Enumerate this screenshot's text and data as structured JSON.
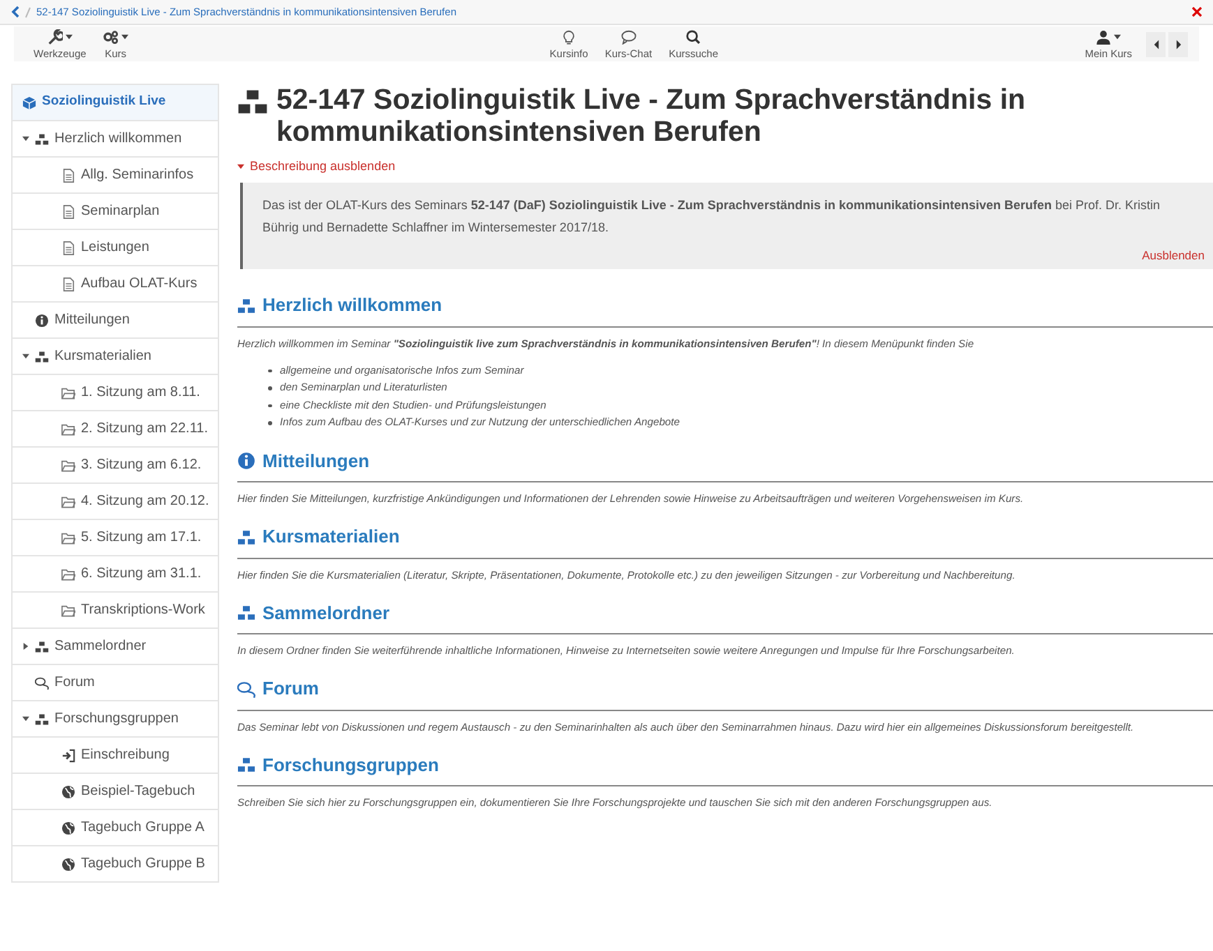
{
  "breadcrumb": {
    "text": "52-147 Soziolinguistik Live - Zum Sprachverständnis in kommunikationsintensiven Berufen"
  },
  "toolbar": {
    "left": [
      {
        "label": "Werkzeuge",
        "kind": "wrench"
      },
      {
        "label": "Kurs",
        "kind": "gears"
      }
    ],
    "center": [
      {
        "label": "Kursinfo",
        "kind": "bulb"
      },
      {
        "label": "Kurs-Chat",
        "kind": "chat"
      },
      {
        "label": "Kurssuche",
        "kind": "search"
      }
    ],
    "right": [
      {
        "label": "Mein Kurs",
        "kind": "user"
      }
    ]
  },
  "sidebar": {
    "root": {
      "label": "Soziolinguistik Live",
      "selected": true
    },
    "items": [
      {
        "label": "Herzlich willkommen",
        "kind": "cubes",
        "selected": false,
        "expanded": true,
        "children": [
          {
            "label": "Allg. Seminarinfos",
            "kind": "doc",
            "selected": false
          },
          {
            "label": "Seminarplan",
            "kind": "doc",
            "selected": false
          },
          {
            "label": "Leistungen",
            "kind": "doc",
            "selected": false
          },
          {
            "label": "Aufbau OLAT-Kurs",
            "kind": "doc",
            "selected": false
          }
        ]
      },
      {
        "label": "Mitteilungen",
        "kind": "info",
        "selected": false
      },
      {
        "label": "Kursmaterialien",
        "kind": "cubes",
        "selected": false,
        "expanded": true,
        "children": [
          {
            "label": "1. Sitzung am 8.11.",
            "kind": "folder",
            "selected": false
          },
          {
            "label": "2. Sitzung am 22.11.",
            "kind": "folder",
            "selected": false
          },
          {
            "label": "3. Sitzung am 6.12.",
            "kind": "folder",
            "selected": false
          },
          {
            "label": "4. Sitzung am 20.12.",
            "kind": "folder",
            "selected": false
          },
          {
            "label": "5. Sitzung am 17.1.",
            "kind": "folder",
            "selected": false
          },
          {
            "label": "6. Sitzung am 31.1.",
            "kind": "folder",
            "selected": false
          },
          {
            "label": "Transkriptions-Work",
            "kind": "folder",
            "selected": false
          }
        ]
      },
      {
        "label": "Sammelordner",
        "kind": "cubes",
        "selected": false,
        "expanded": false
      },
      {
        "label": "Forum",
        "kind": "forum",
        "selected": false
      },
      {
        "label": "Forschungsgruppen",
        "kind": "cubes",
        "selected": false,
        "expanded": true,
        "children": [
          {
            "label": "Einschreibung",
            "kind": "login",
            "selected": false
          },
          {
            "label": "Beispiel-Tagebuch",
            "kind": "globe",
            "selected": false
          },
          {
            "label": "Tagebuch Gruppe A",
            "kind": "globe",
            "selected": false
          },
          {
            "label": "Tagebuch Gruppe B",
            "kind": "globe",
            "selected": false
          }
        ]
      }
    ]
  },
  "main": {
    "title": "52-147 Soziolinguistik Live - Zum Sprachverständnis in kommunikationsintensiven Berufen",
    "description_toggle": "Beschreibung ausblenden",
    "description": "Das ist der OLAT-Kurs des Seminars **52-147 (DaF) Soziolinguistik Live - Zum Sprachverständnis in kommunikationsintensiven Berufen** bei Prof. Dr. Kristin Bührig und Bernadette Schlaffner im Wintersemester 2017/18.",
    "hide_link": "Ausblenden",
    "sections": [
      {
        "heading": "Herzlich willkommen",
        "kind": "cubes",
        "text": "Herzlich willkommen im Seminar **\"Soziolinguistik live zum Sprachverständnis in kommunikationsintensiven Berufen\"**! In diesem Menüpunkt finden Sie",
        "bullets": [
          "allgemeine und organisatorische Infos zum Seminar",
          "den Seminarplan und Literaturlisten",
          "eine Checkliste mit den Studien- und Prüfungsleistungen",
          "Infos zum Aufbau des OLAT-Kurses und zur Nutzung der unterschiedlichen Angebote"
        ]
      },
      {
        "heading": "Mitteilungen",
        "kind": "info",
        "text": "Hier finden Sie Mitteilungen, kurzfristige Ankündigungen und Informationen der Lehrenden sowie Hinweise zu Arbeitsaufträgen und weiteren Vorgehensweisen im Kurs."
      },
      {
        "heading": "Kursmaterialien",
        "kind": "cubes",
        "text": "Hier finden Sie die Kursmaterialien (Literatur, Skripte, Präsentationen, Dokumente, Protokolle etc.) zu den jeweiligen Sitzungen - zur Vorbereitung und Nachbereitung."
      },
      {
        "heading": "Sammelordner",
        "kind": "cubes",
        "text": "In diesem Ordner finden Sie weiterführende inhaltliche Informationen, Hinweise zu Internetseiten sowie weitere Anregungen und Impulse für Ihre Forschungsarbeiten."
      },
      {
        "heading": "Forum",
        "kind": "forum",
        "text": "Das Seminar lebt von Diskussionen und regem Austausch - zu den Seminarinhalten als auch über den Seminarrahmen hinaus. Dazu wird hier ein allgemeines Diskussionsforum bereitgestellt."
      },
      {
        "heading": "Forschungsgruppen",
        "kind": "cubes",
        "text": "Schreiben Sie sich hier zu Forschungsgruppen ein, dokumentieren Sie Ihre Forschungsprojekte und tauschen Sie sich mit den anderen Forschungsgruppen aus."
      }
    ]
  }
}
